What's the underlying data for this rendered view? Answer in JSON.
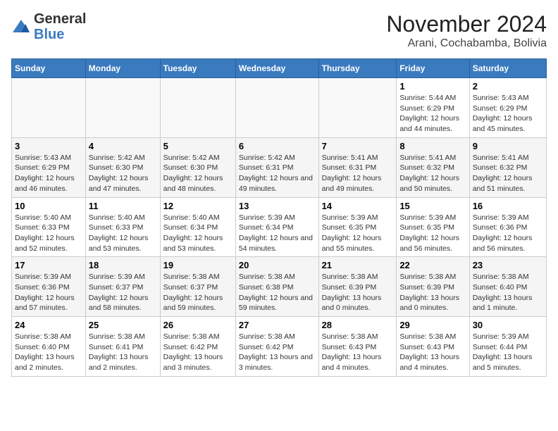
{
  "logo": {
    "general": "General",
    "blue": "Blue"
  },
  "title": "November 2024",
  "location": "Arani, Cochabamba, Bolivia",
  "days_of_week": [
    "Sunday",
    "Monday",
    "Tuesday",
    "Wednesday",
    "Thursday",
    "Friday",
    "Saturday"
  ],
  "weeks": [
    [
      {
        "day": "",
        "info": ""
      },
      {
        "day": "",
        "info": ""
      },
      {
        "day": "",
        "info": ""
      },
      {
        "day": "",
        "info": ""
      },
      {
        "day": "",
        "info": ""
      },
      {
        "day": "1",
        "info": "Sunrise: 5:44 AM\nSunset: 6:29 PM\nDaylight: 12 hours and 44 minutes."
      },
      {
        "day": "2",
        "info": "Sunrise: 5:43 AM\nSunset: 6:29 PM\nDaylight: 12 hours and 45 minutes."
      }
    ],
    [
      {
        "day": "3",
        "info": "Sunrise: 5:43 AM\nSunset: 6:29 PM\nDaylight: 12 hours and 46 minutes."
      },
      {
        "day": "4",
        "info": "Sunrise: 5:42 AM\nSunset: 6:30 PM\nDaylight: 12 hours and 47 minutes."
      },
      {
        "day": "5",
        "info": "Sunrise: 5:42 AM\nSunset: 6:30 PM\nDaylight: 12 hours and 48 minutes."
      },
      {
        "day": "6",
        "info": "Sunrise: 5:42 AM\nSunset: 6:31 PM\nDaylight: 12 hours and 49 minutes."
      },
      {
        "day": "7",
        "info": "Sunrise: 5:41 AM\nSunset: 6:31 PM\nDaylight: 12 hours and 49 minutes."
      },
      {
        "day": "8",
        "info": "Sunrise: 5:41 AM\nSunset: 6:32 PM\nDaylight: 12 hours and 50 minutes."
      },
      {
        "day": "9",
        "info": "Sunrise: 5:41 AM\nSunset: 6:32 PM\nDaylight: 12 hours and 51 minutes."
      }
    ],
    [
      {
        "day": "10",
        "info": "Sunrise: 5:40 AM\nSunset: 6:33 PM\nDaylight: 12 hours and 52 minutes."
      },
      {
        "day": "11",
        "info": "Sunrise: 5:40 AM\nSunset: 6:33 PM\nDaylight: 12 hours and 53 minutes."
      },
      {
        "day": "12",
        "info": "Sunrise: 5:40 AM\nSunset: 6:34 PM\nDaylight: 12 hours and 53 minutes."
      },
      {
        "day": "13",
        "info": "Sunrise: 5:39 AM\nSunset: 6:34 PM\nDaylight: 12 hours and 54 minutes."
      },
      {
        "day": "14",
        "info": "Sunrise: 5:39 AM\nSunset: 6:35 PM\nDaylight: 12 hours and 55 minutes."
      },
      {
        "day": "15",
        "info": "Sunrise: 5:39 AM\nSunset: 6:35 PM\nDaylight: 12 hours and 56 minutes."
      },
      {
        "day": "16",
        "info": "Sunrise: 5:39 AM\nSunset: 6:36 PM\nDaylight: 12 hours and 56 minutes."
      }
    ],
    [
      {
        "day": "17",
        "info": "Sunrise: 5:39 AM\nSunset: 6:36 PM\nDaylight: 12 hours and 57 minutes."
      },
      {
        "day": "18",
        "info": "Sunrise: 5:39 AM\nSunset: 6:37 PM\nDaylight: 12 hours and 58 minutes."
      },
      {
        "day": "19",
        "info": "Sunrise: 5:38 AM\nSunset: 6:37 PM\nDaylight: 12 hours and 59 minutes."
      },
      {
        "day": "20",
        "info": "Sunrise: 5:38 AM\nSunset: 6:38 PM\nDaylight: 12 hours and 59 minutes."
      },
      {
        "day": "21",
        "info": "Sunrise: 5:38 AM\nSunset: 6:39 PM\nDaylight: 13 hours and 0 minutes."
      },
      {
        "day": "22",
        "info": "Sunrise: 5:38 AM\nSunset: 6:39 PM\nDaylight: 13 hours and 0 minutes."
      },
      {
        "day": "23",
        "info": "Sunrise: 5:38 AM\nSunset: 6:40 PM\nDaylight: 13 hours and 1 minute."
      }
    ],
    [
      {
        "day": "24",
        "info": "Sunrise: 5:38 AM\nSunset: 6:40 PM\nDaylight: 13 hours and 2 minutes."
      },
      {
        "day": "25",
        "info": "Sunrise: 5:38 AM\nSunset: 6:41 PM\nDaylight: 13 hours and 2 minutes."
      },
      {
        "day": "26",
        "info": "Sunrise: 5:38 AM\nSunset: 6:42 PM\nDaylight: 13 hours and 3 minutes."
      },
      {
        "day": "27",
        "info": "Sunrise: 5:38 AM\nSunset: 6:42 PM\nDaylight: 13 hours and 3 minutes."
      },
      {
        "day": "28",
        "info": "Sunrise: 5:38 AM\nSunset: 6:43 PM\nDaylight: 13 hours and 4 minutes."
      },
      {
        "day": "29",
        "info": "Sunrise: 5:38 AM\nSunset: 6:43 PM\nDaylight: 13 hours and 4 minutes."
      },
      {
        "day": "30",
        "info": "Sunrise: 5:39 AM\nSunset: 6:44 PM\nDaylight: 13 hours and 5 minutes."
      }
    ]
  ]
}
